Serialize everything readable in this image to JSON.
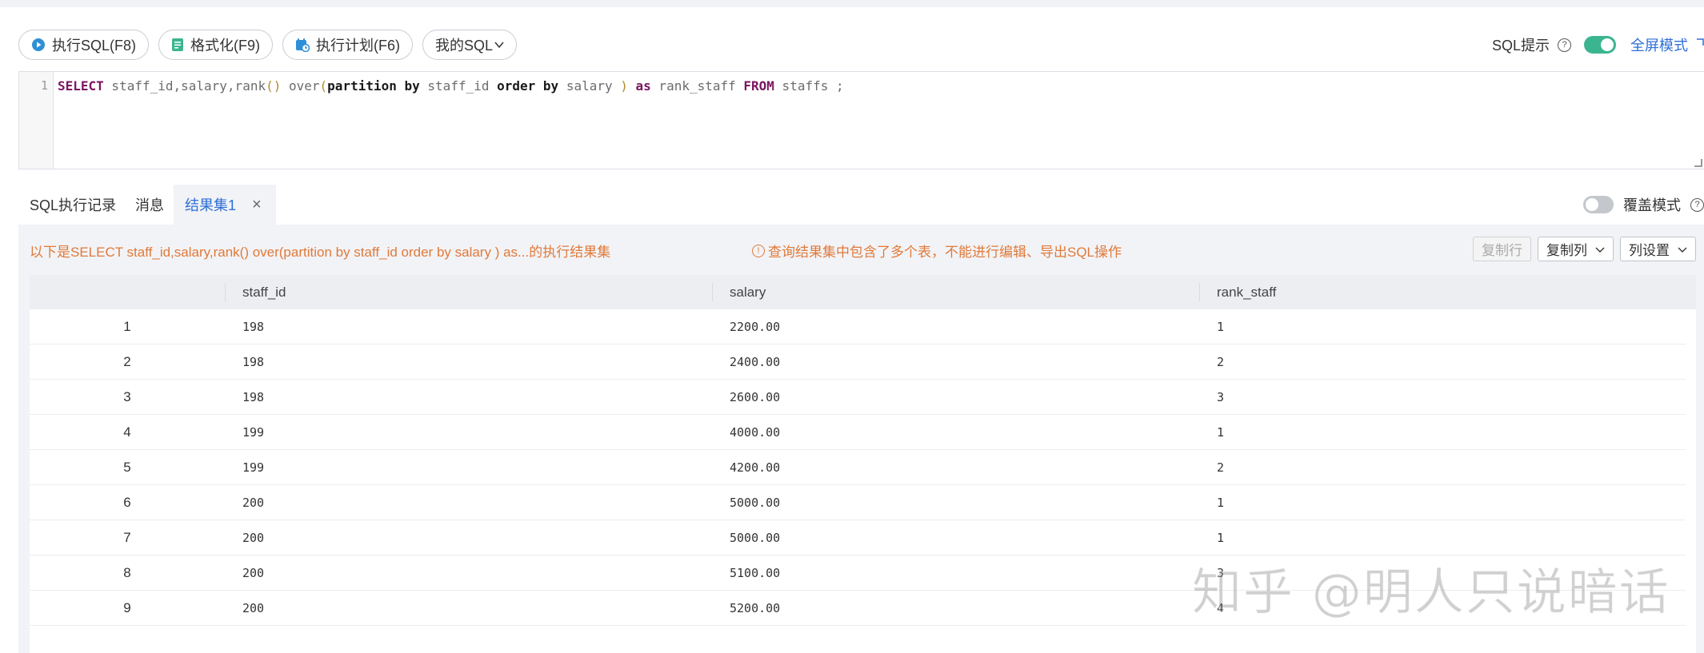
{
  "toolbar": {
    "run_sql": "执行SQL(F8)",
    "format": "格式化(F9)",
    "explain": "执行计划(F6)",
    "my_sql": "我的SQL"
  },
  "top_right": {
    "sql_hint": "SQL提示",
    "fullscreen": "全屏模式"
  },
  "editor": {
    "line_number": "1",
    "tokens": {
      "select": "SELECT",
      "cols": " staff_id,salary,rank",
      "p1": "()",
      "over": " over",
      "p2": "(",
      "partition": "partition",
      "by1": " by",
      "col1": " staff_id ",
      "order": "order",
      "by2": " by",
      "col2": " salary ",
      "p3": ")",
      "as": " as",
      "alias": " rank_staff ",
      "from": "FROM",
      "tail": " staffs ;"
    }
  },
  "tabs": {
    "history": "SQL执行记录",
    "messages": "消息",
    "result": "结果集1",
    "close": "×"
  },
  "cover_mode": "覆盖模式",
  "result": {
    "info": "以下是SELECT staff_id,salary,rank() over(partition by staff_id order by salary ) as...的执行结果集",
    "warning": "查询结果集中包含了多个表，不能进行编辑、导出SQL操作",
    "copy_row": "复制行",
    "copy_col": "复制列",
    "col_settings": "列设置"
  },
  "table": {
    "columns": [
      "",
      "staff_id",
      "salary",
      "rank_staff"
    ],
    "rows": [
      {
        "n": "1",
        "staff_id": "198",
        "salary": "2200.00",
        "rank": "1"
      },
      {
        "n": "2",
        "staff_id": "198",
        "salary": "2400.00",
        "rank": "2"
      },
      {
        "n": "3",
        "staff_id": "198",
        "salary": "2600.00",
        "rank": "3"
      },
      {
        "n": "4",
        "staff_id": "199",
        "salary": "4000.00",
        "rank": "1"
      },
      {
        "n": "5",
        "staff_id": "199",
        "salary": "4200.00",
        "rank": "2"
      },
      {
        "n": "6",
        "staff_id": "200",
        "salary": "5000.00",
        "rank": "1"
      },
      {
        "n": "7",
        "staff_id": "200",
        "salary": "5000.00",
        "rank": "1"
      },
      {
        "n": "8",
        "staff_id": "200",
        "salary": "5100.00",
        "rank": "3"
      },
      {
        "n": "9",
        "staff_id": "200",
        "salary": "5200.00",
        "rank": "4"
      }
    ]
  },
  "watermark": "知乎 @明人只说暗话",
  "colors": {
    "accent_blue": "#2f6fd6",
    "toggle_green": "#3bb58f",
    "warning_orange": "#e07a3a",
    "keyword_purple": "#7b1660"
  }
}
